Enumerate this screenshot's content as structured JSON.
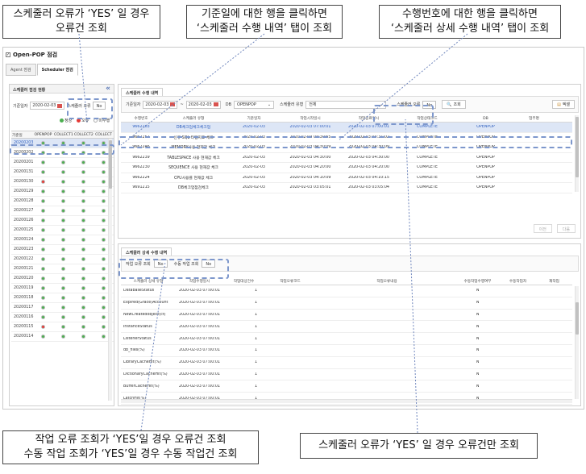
{
  "callouts": {
    "top_left": [
      "스케줄러 오류가 ‘YES’ 일 경우",
      "오류건 조회"
    ],
    "top_mid": [
      "기준일에 대한 행을 클릭하면",
      "‘스케줄러 수행 내역’ 탭이 조회"
    ],
    "top_right": [
      "수행번호에 대한 행을 클릭하면",
      "‘스케줄러 상세 수행 내역’ 탭이 조회"
    ],
    "bottom_left": [
      "작업 오류 조회가 ‘YES’일 경우 오류건 조회",
      "수동 작업 조회가 ‘YES’일 경우 수동 작업건 조회"
    ],
    "bottom_right": [
      "스케줄러 오류가 ‘YES’ 일 경우 오류건만 조회"
    ]
  },
  "app": {
    "title": "Open-POP 점검",
    "tabs": [
      "Agent 점검",
      "Scheduler 점검"
    ]
  },
  "left_panel": {
    "title": "스케줄러 점검 현황",
    "date_label": "기준일자",
    "date_value": "2020-02-03",
    "error_label": "스케줄러 오류",
    "error_value": "No",
    "legend": [
      "정상",
      "오류",
      "미수행"
    ],
    "columns": [
      "기준일",
      "OPENPOP",
      "COLLECT1",
      "COLLECT2",
      "COLLECT"
    ],
    "rows": [
      {
        "date": "20200203",
        "s": [
          "ok",
          "ok",
          "ok",
          "ok"
        ]
      },
      {
        "date": "20200202",
        "s": [
          "ok",
          "ok",
          "ok",
          "ok"
        ]
      },
      {
        "date": "20200201",
        "s": [
          "ok",
          "ok",
          "ok",
          "ok"
        ]
      },
      {
        "date": "20200131",
        "s": [
          "ok",
          "ok",
          "ok",
          "ok"
        ]
      },
      {
        "date": "20200130",
        "s": [
          "err",
          "ok",
          "ok",
          "ok"
        ]
      },
      {
        "date": "20200129",
        "s": [
          "ok",
          "ok",
          "ok",
          "ok"
        ]
      },
      {
        "date": "20200128",
        "s": [
          "ok",
          "ok",
          "ok",
          "ok"
        ]
      },
      {
        "date": "20200127",
        "s": [
          "ok",
          "ok",
          "ok",
          "ok"
        ]
      },
      {
        "date": "20200126",
        "s": [
          "ok",
          "ok",
          "ok",
          "ok"
        ]
      },
      {
        "date": "20200125",
        "s": [
          "ok",
          "ok",
          "ok",
          "ok"
        ]
      },
      {
        "date": "20200124",
        "s": [
          "ok",
          "ok",
          "ok",
          "ok"
        ]
      },
      {
        "date": "20200123",
        "s": [
          "ok",
          "ok",
          "ok",
          "ok"
        ]
      },
      {
        "date": "20200122",
        "s": [
          "ok",
          "ok",
          "ok",
          "ok"
        ]
      },
      {
        "date": "20200121",
        "s": [
          "ok",
          "ok",
          "ok",
          "ok"
        ]
      },
      {
        "date": "20200120",
        "s": [
          "ok",
          "ok",
          "ok",
          "ok"
        ]
      },
      {
        "date": "20200119",
        "s": [
          "ok",
          "ok",
          "ok",
          "ok"
        ]
      },
      {
        "date": "20200118",
        "s": [
          "ok",
          "ok",
          "ok",
          "ok"
        ]
      },
      {
        "date": "20200117",
        "s": [
          "ok",
          "ok",
          "ok",
          "ok"
        ]
      },
      {
        "date": "20200116",
        "s": [
          "ok",
          "ok",
          "ok",
          "ok"
        ]
      },
      {
        "date": "20200115",
        "s": [
          "err",
          "ok",
          "ok",
          "ok"
        ]
      },
      {
        "date": "20200114",
        "s": [
          "ok",
          "ok",
          "ok",
          "ok"
        ]
      }
    ]
  },
  "exec_panel": {
    "tab": "스케줄러 수행 내역",
    "date_label": "기준일자",
    "date_from": "2020-02-03",
    "date_to": "2020-02-03",
    "db_label": "DB",
    "db_value": "OPENPOP",
    "type_label": "스케줄러 유형",
    "type_value": "전체",
    "error_label": "스케줄러 오류",
    "error_value": "No",
    "search_btn": "조회",
    "excel_btn": "엑셀",
    "columns": [
      "수행번호",
      "스케줄러 유형",
      "기준일자",
      "작업시작일시",
      "작업종료일시",
      "작업상태코드",
      "DB",
      "업무명"
    ],
    "rows": [
      [
        "9662263",
        "DB체크업체크체크업",
        "2020-02-03",
        "2020-02-03 07:00:01",
        "2020-02-03 07:00:01",
        "COMPLETE",
        "OPENPOP",
        ""
      ],
      [
        "9662251",
        "신규 SQL 타입지표 체크",
        "2020-02-03",
        "2020-02-03 04:30:55",
        "2020-02-03 04:31:02",
        "COMPLETE",
        "OPENPOP",
        ""
      ],
      [
        "9662246",
        "MEMORY사용 현재값 체크",
        "2020-02-03",
        "2020-02-03 04:30:09",
        "2020-02-03 04:30:09",
        "COMPLETE",
        "OPENPOP",
        ""
      ],
      [
        "9662239",
        "TABLESPACE 사용 현재값 체크",
        "2020-02-03",
        "2020-02-03 04:30:00",
        "2020-02-03 04:30:00",
        "COMPLETE",
        "OPENPOP",
        ""
      ],
      [
        "9662230",
        "SEQUENCE 사용 현재값 체크",
        "2020-02-03",
        "2020-02-03 04:20:00",
        "2020-02-03 04:20:00",
        "COMPLETE",
        "OPENPOP",
        ""
      ],
      [
        "9662224",
        "CPU사용률 현재값 체크",
        "2020-02-03",
        "2020-02-03 04:10:09",
        "2020-02-03 04:10:15",
        "COMPLETE",
        "OPENPOP",
        ""
      ],
      [
        "9691215",
        "DB체크업점검체크",
        "2020-02-03",
        "2020-02-03 03:05:01",
        "2020-02-03 03:05:04",
        "COMPLETE",
        "OPENPOP",
        ""
      ]
    ],
    "prev_btn": "이전",
    "next_btn": "다음"
  },
  "detail_panel": {
    "tab": "스케줄러 상세 수행 내역",
    "err_label": "작업 오류 조회",
    "err_value": "No",
    "manual_label": "수동 작업 조회",
    "manual_value": "No",
    "columns": [
      "스케줄러 상세 유형",
      "작업수행일시",
      "작업대상건수",
      "작업오류코드",
      "작업오류내용",
      "수동작업수행여부",
      "수동작업자",
      "재작업"
    ],
    "rows": [
      [
        "DatabaseStatus",
        "2020-02-03 07:00:01",
        "1",
        "",
        "",
        "N",
        "",
        ""
      ],
      [
        "Expired(Grace)Account",
        "2020-02-03 07:00:01",
        "1",
        "",
        "",
        "N",
        "",
        ""
      ],
      [
        "NewCreatedobject(ct)",
        "2020-02-03 07:00:01",
        "1",
        "",
        "",
        "N",
        "",
        ""
      ],
      [
        "InstanceStatus",
        "2020-02-03 07:00:01",
        "1",
        "",
        "",
        "N",
        "",
        ""
      ],
      [
        "ListenerStatus",
        "2020-02-03 07:00:01",
        "1",
        "",
        "",
        "N",
        "",
        ""
      ],
      [
        "db_files(%)",
        "2020-02-03 07:00:01",
        "1",
        "",
        "",
        "N",
        "",
        ""
      ],
      [
        "LibraryCacheHit(%)",
        "2020-02-03 07:00:01",
        "1",
        "",
        "",
        "N",
        "",
        ""
      ],
      [
        "DictionaryCacheHit(%)",
        "2020-02-03 07:00:01",
        "1",
        "",
        "",
        "N",
        "",
        ""
      ],
      [
        "BufferCacheHit(%)",
        "2020-02-03 07:00:01",
        "1",
        "",
        "",
        "N",
        "",
        ""
      ],
      [
        "LatchHit(%)",
        "2020-02-03 07:00:01",
        "1",
        "",
        "",
        "N",
        "",
        ""
      ]
    ]
  },
  "colors": {
    "accent": "#7d97cc",
    "selected_row": "#dde6f6",
    "status_ok": "#4caf50",
    "status_err": "#e53935"
  }
}
